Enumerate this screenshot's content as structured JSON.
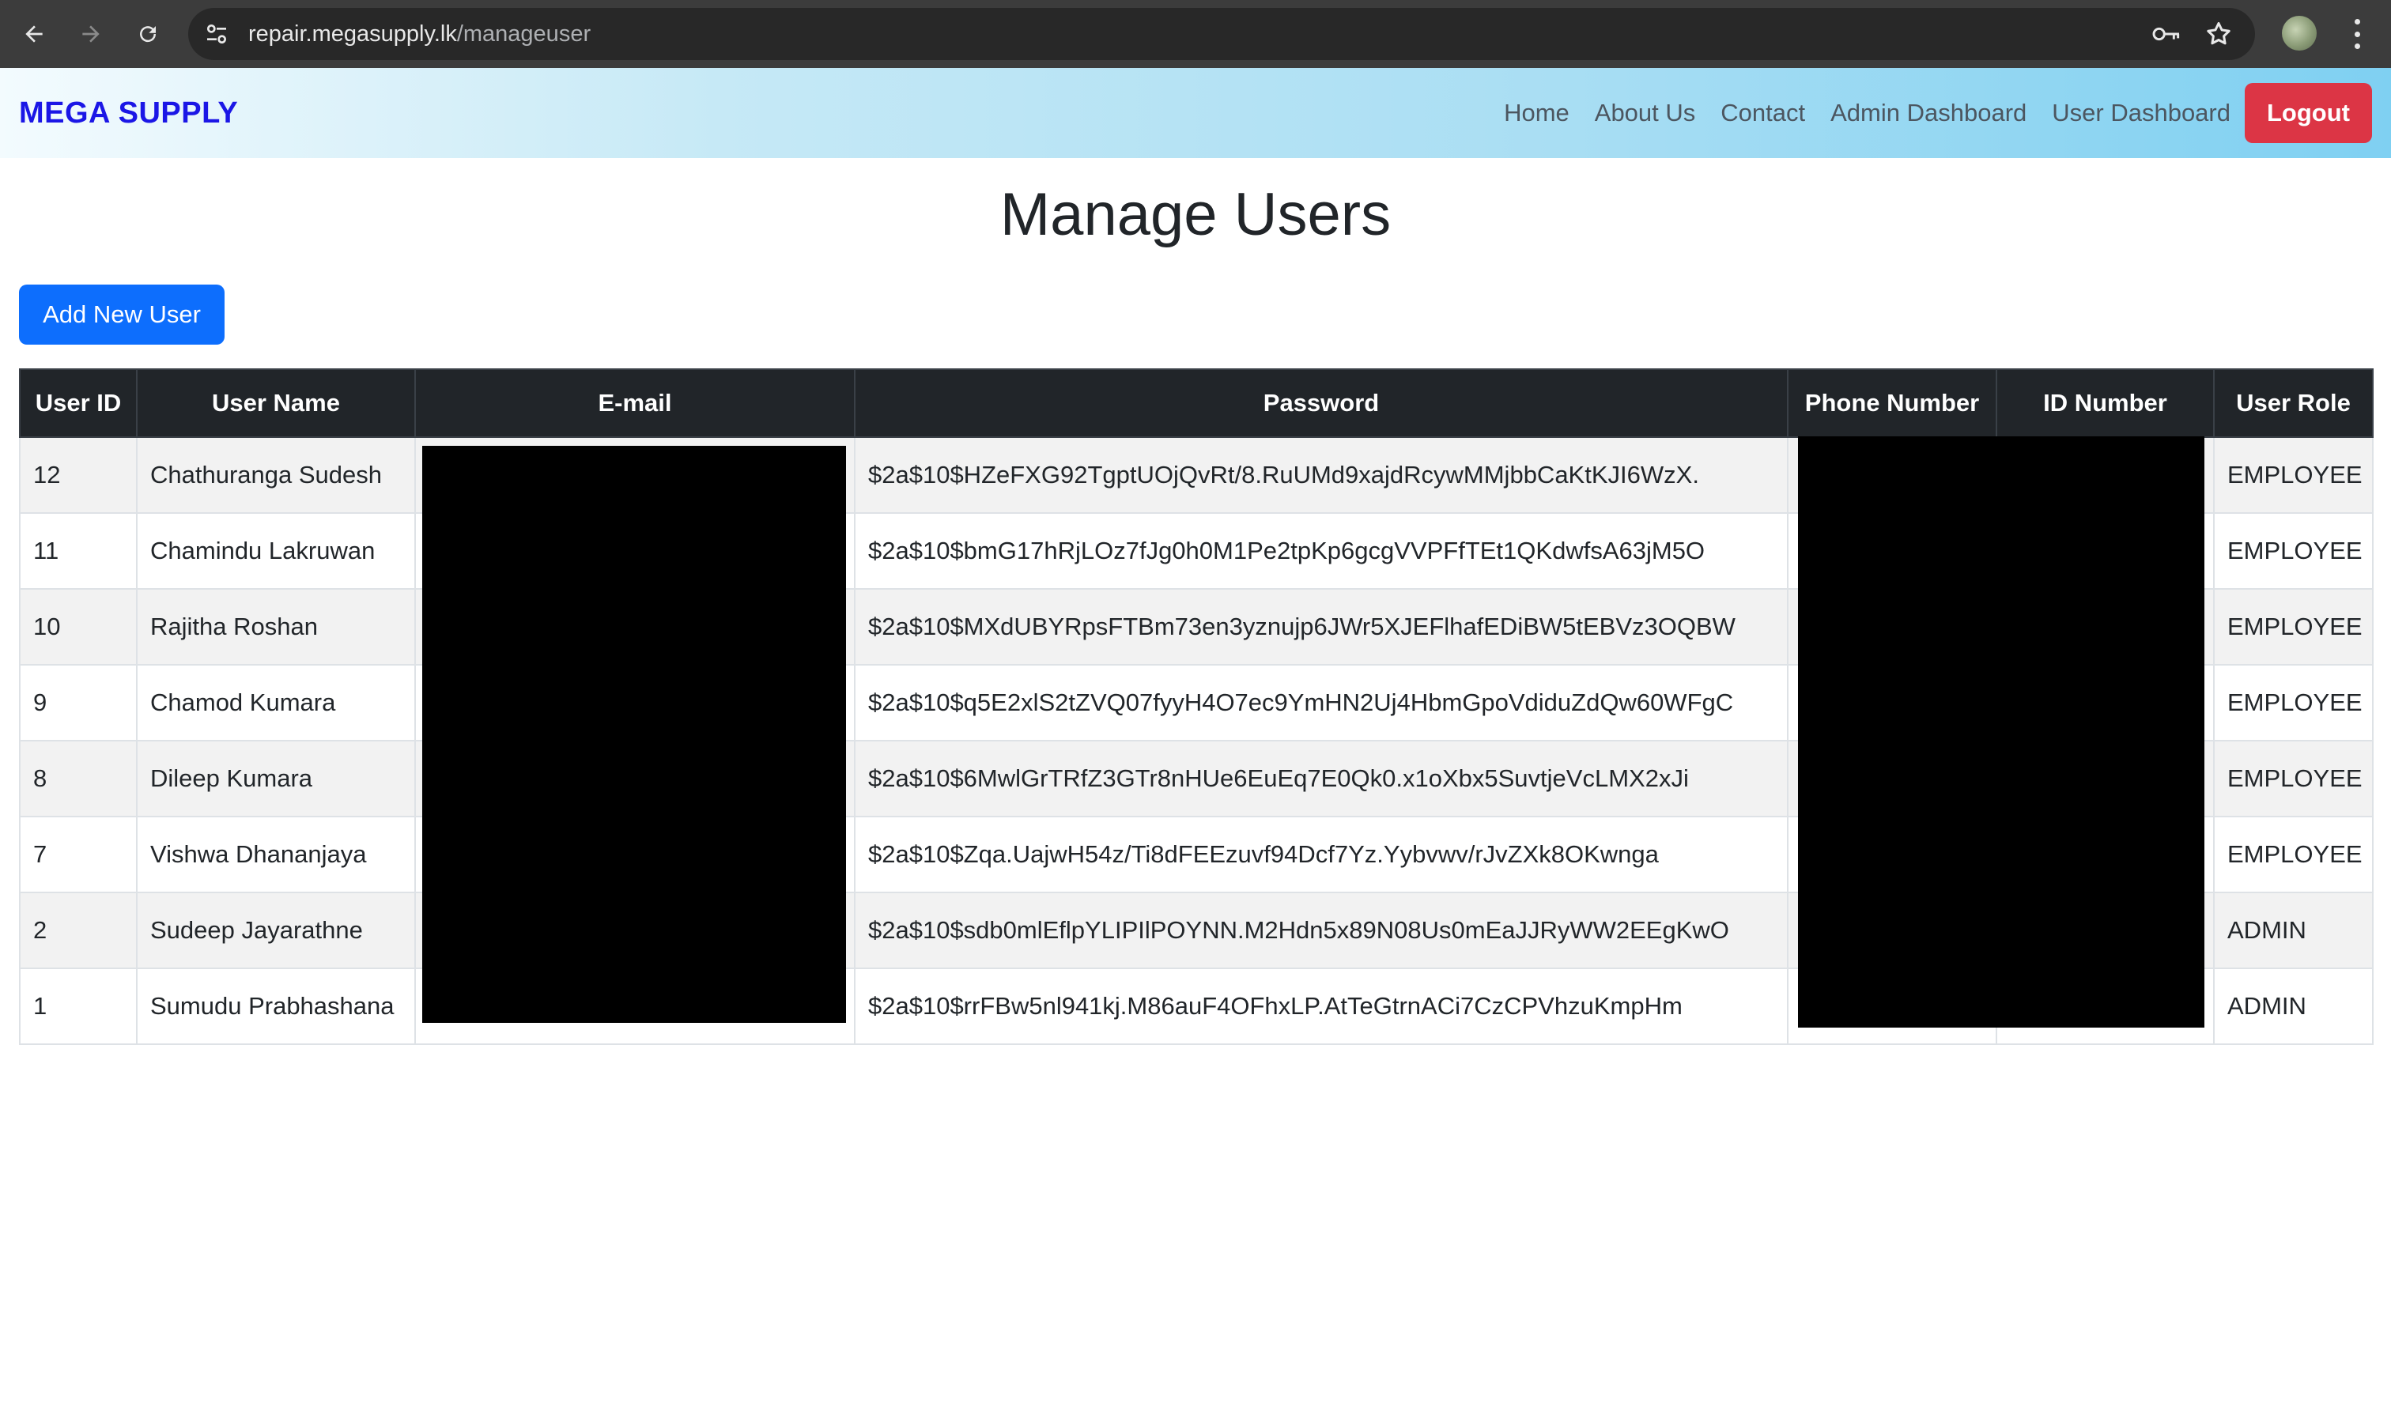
{
  "browser": {
    "url_host": "repair.megasupply.lk",
    "url_path": "/manageuser",
    "back_icon": "arrow-left-icon",
    "forward_icon": "arrow-right-icon",
    "reload_icon": "reload-icon",
    "site_settings_icon": "tune-icon",
    "password_icon": "key-icon",
    "bookmark_icon": "star-icon",
    "menu_icon": "three-dots-vertical-icon"
  },
  "navbar": {
    "brand": "MEGA SUPPLY",
    "links": [
      "Home",
      "About Us",
      "Contact",
      "Admin Dashboard",
      "User Dashboard"
    ],
    "logout": "Logout"
  },
  "page": {
    "title": "Manage Users",
    "add_button": "Add New User"
  },
  "table": {
    "headers": [
      "User ID",
      "User Name",
      "E-mail",
      "Password",
      "Phone Number",
      "ID Number",
      "User Role"
    ],
    "rows": [
      {
        "id": "12",
        "name": "Chathuranga Sudesh",
        "password": "$2a$10$HZeFXG92TgptUOjQvRt/8.RuUMd9xajdRcywMMjbbCaKtKJI6WzX.",
        "role": "EMPLOYEE"
      },
      {
        "id": "11",
        "name": "Chamindu Lakruwan",
        "password": "$2a$10$bmG17hRjLOz7fJg0h0M1Pe2tpKp6gcgVVPFfTEt1QKdwfsA63jM5O",
        "role": "EMPLOYEE"
      },
      {
        "id": "10",
        "name": "Rajitha Roshan",
        "password": "$2a$10$MXdUBYRpsFTBm73en3yznujp6JWr5XJEFlhafEDiBW5tEBVz3OQBW",
        "role": "EMPLOYEE"
      },
      {
        "id": "9",
        "name": "Chamod Kumara",
        "password": "$2a$10$q5E2xlS2tZVQ07fyyH4O7ec9YmHN2Uj4HbmGpoVdiduZdQw60WFgC",
        "role": "EMPLOYEE"
      },
      {
        "id": "8",
        "name": "Dileep Kumara",
        "password": "$2a$10$6MwlGrTRfZ3GTr8nHUe6EuEq7E0Qk0.x1oXbx5SuvtjeVcLMX2xJi",
        "role": "EMPLOYEE"
      },
      {
        "id": "7",
        "name": "Vishwa Dhananjaya",
        "password": "$2a$10$Zqa.UajwH54z/Ti8dFEEzuvf94Dcf7Yz.Yybvwv/rJvZXk8OKwnga",
        "role": "EMPLOYEE"
      },
      {
        "id": "2",
        "name": "Sudeep Jayarathne",
        "password": "$2a$10$sdb0mlEflpYLIPIlPOYNN.M2Hdn5x89N08Us0mEaJJRyWW2EEgKwO",
        "role": "ADMIN"
      },
      {
        "id": "1",
        "name": "Sumudu Prabhashana",
        "password": "$2a$10$rrFBw5nl941kj.M86auF4OFhxLP.AtTeGtrnACi7CzCPVhzuKmpHm",
        "role": "ADMIN"
      }
    ]
  },
  "colors": {
    "brand": "#1b16e6",
    "logout": "#dc3545",
    "primary_button": "#0d6efd",
    "table_header": "#212529"
  }
}
